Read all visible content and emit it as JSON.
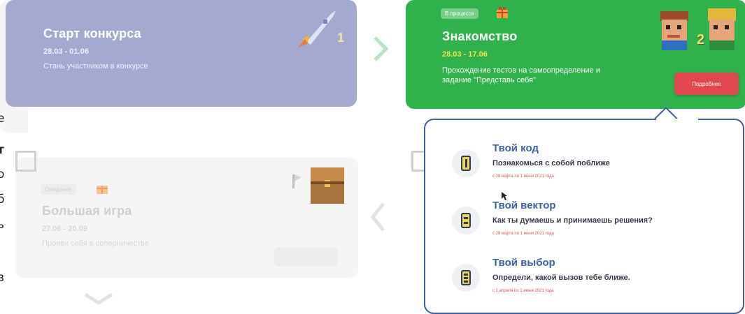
{
  "stages": {
    "start": {
      "title": "Старт конкурса",
      "dates": "28.03 - 01.06",
      "desc": "Стань участником в конкурсе",
      "number": "1"
    },
    "meet": {
      "chip": "В процессе",
      "title": "Знакомство",
      "dates": "28.03 - 17.06",
      "desc_line1": "Прохождение тестов на самоопределение и",
      "desc_line2": "задание \"Представь себя\"",
      "number": "2",
      "more_button": "Подробнее"
    },
    "game": {
      "chip": "Ожидание",
      "title": "Большая игра",
      "dates": "27.06 - 20.09",
      "desc": "Прояви себя в соперничестве"
    }
  },
  "popup": {
    "items": [
      {
        "num": "1",
        "title": "Твой код",
        "subtitle": "Познакомься с собой поближе",
        "date": "с 28 марта по 1 июня 2021 года"
      },
      {
        "num": "2",
        "title": "Твой вектор",
        "subtitle": "Как ты думаешь и принимаешь решения?",
        "date": "с 28 марта по 1 июня 2021 года"
      },
      {
        "num": "3",
        "title": "Твой выбор",
        "subtitle": "Определи, какой вызов тебе ближе.",
        "date": "с 1 апреля по 1 июня 2021 года"
      }
    ]
  },
  "left_edge": [
    "е",
    "т",
    "о",
    "б",
    "ь",
    "в"
  ],
  "colors": {
    "start_card": "#a4a9cf",
    "meet_card": "#2fb24c",
    "popup_border": "#3b5fa0",
    "accent_red": "#e0474f",
    "title_blue": "#3d62a8"
  }
}
